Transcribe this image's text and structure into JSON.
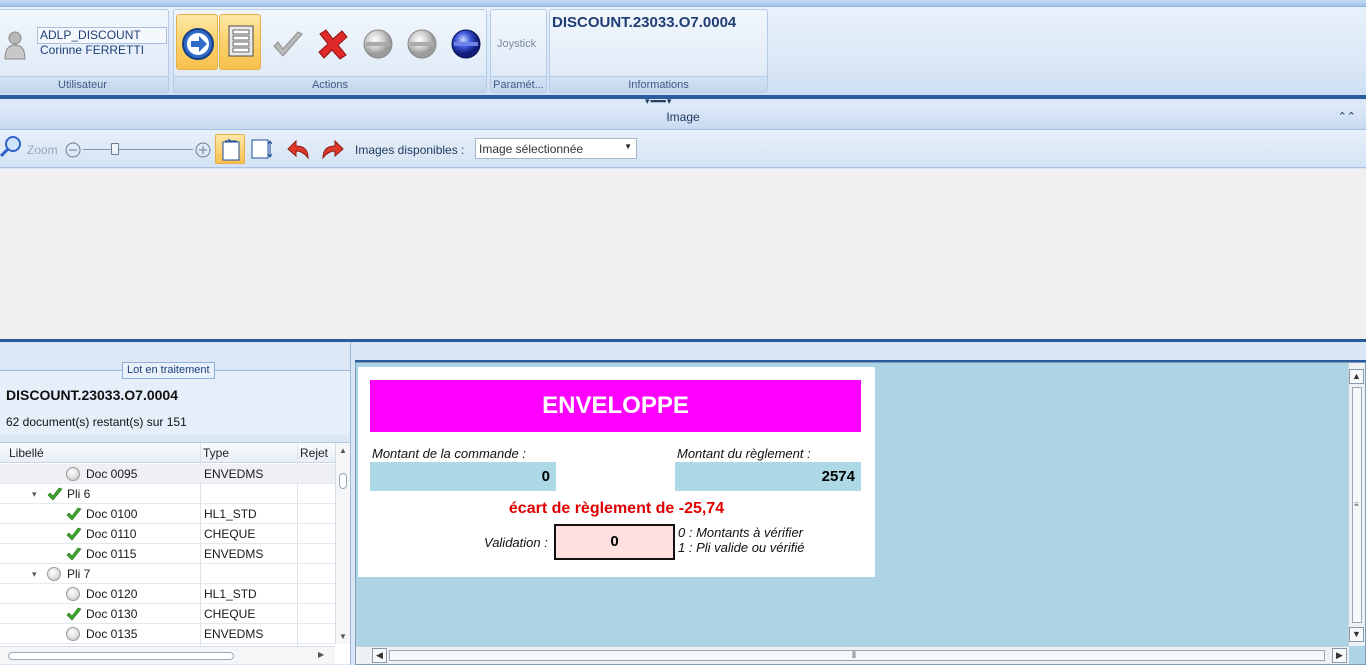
{
  "ribbon": {
    "user_group": {
      "login": "ADLP_DISCOUNT",
      "name": "Corinne FERRETTI",
      "label": "Utilisateur"
    },
    "actions_label": "Actions",
    "params": {
      "joystick_label": "Joystick",
      "label": "Paramét..."
    },
    "info": {
      "title": "DISCOUNT.23033.O7.0004",
      "label": "Informations"
    }
  },
  "image_panel": {
    "header": "Image",
    "zoom_label": "Zoom",
    "images_label": "Images disponibles :",
    "images_select_value": "Image sélectionnée"
  },
  "lot": {
    "tab_label": "Lot en traitement",
    "title": "DISCOUNT.23033.O7.0004",
    "remaining": "62 document(s) restant(s) sur 151"
  },
  "tree": {
    "columns": [
      "Libellé",
      "Type",
      "Rejet"
    ],
    "rows": [
      {
        "label": "Doc 0095",
        "type": "ENVEDMS",
        "status": "ring",
        "level": 2
      },
      {
        "label": "Pli 6",
        "type": "",
        "status": "check",
        "level": 1
      },
      {
        "label": "Doc 0100",
        "type": "HL1_STD",
        "status": "check",
        "level": 2
      },
      {
        "label": "Doc 0110",
        "type": "CHEQUE",
        "status": "check",
        "level": 2
      },
      {
        "label": "Doc 0115",
        "type": "ENVEDMS",
        "status": "check",
        "level": 2
      },
      {
        "label": "Pli 7",
        "type": "",
        "status": "ring",
        "level": 1
      },
      {
        "label": "Doc 0120",
        "type": "HL1_STD",
        "status": "ring",
        "level": 2
      },
      {
        "label": "Doc 0130",
        "type": "CHEQUE",
        "status": "check",
        "level": 2
      },
      {
        "label": "Doc 0135",
        "type": "ENVEDMS",
        "status": "ring",
        "level": 2
      }
    ]
  },
  "form": {
    "banner": "ENVELOPPE",
    "order_amount_label": "Montant de la commande :",
    "order_amount": "0",
    "payment_amount_label": "Montant du règlement :",
    "payment_amount": "2574",
    "gap_text": "écart de règlement de -25,74",
    "validation_label": "Validation :",
    "validation_value": "0",
    "legend_0": "0 : Montants à vérifier",
    "legend_1": "1 : Pli valide ou vérifié"
  },
  "colors": {
    "banner_bg": "#ff00ff",
    "amount_bg": "#add8e6",
    "gap_text": "#e00000",
    "validation_bg": "#fde0df",
    "panel_bg": "#acd4e4",
    "selected_button": "#fbd26a"
  },
  "icons": [
    "user-icon",
    "next-arrow-icon",
    "copy-document-icon",
    "validate-check-icon",
    "reject-cross-icon",
    "grey-circle-icon",
    "grey-circle-icon",
    "blue-circle-icon",
    "search-icon",
    "zoom-out-icon",
    "zoom-in-icon",
    "fit-page-icon",
    "fit-width-icon",
    "rotate-left-icon",
    "rotate-right-icon"
  ]
}
